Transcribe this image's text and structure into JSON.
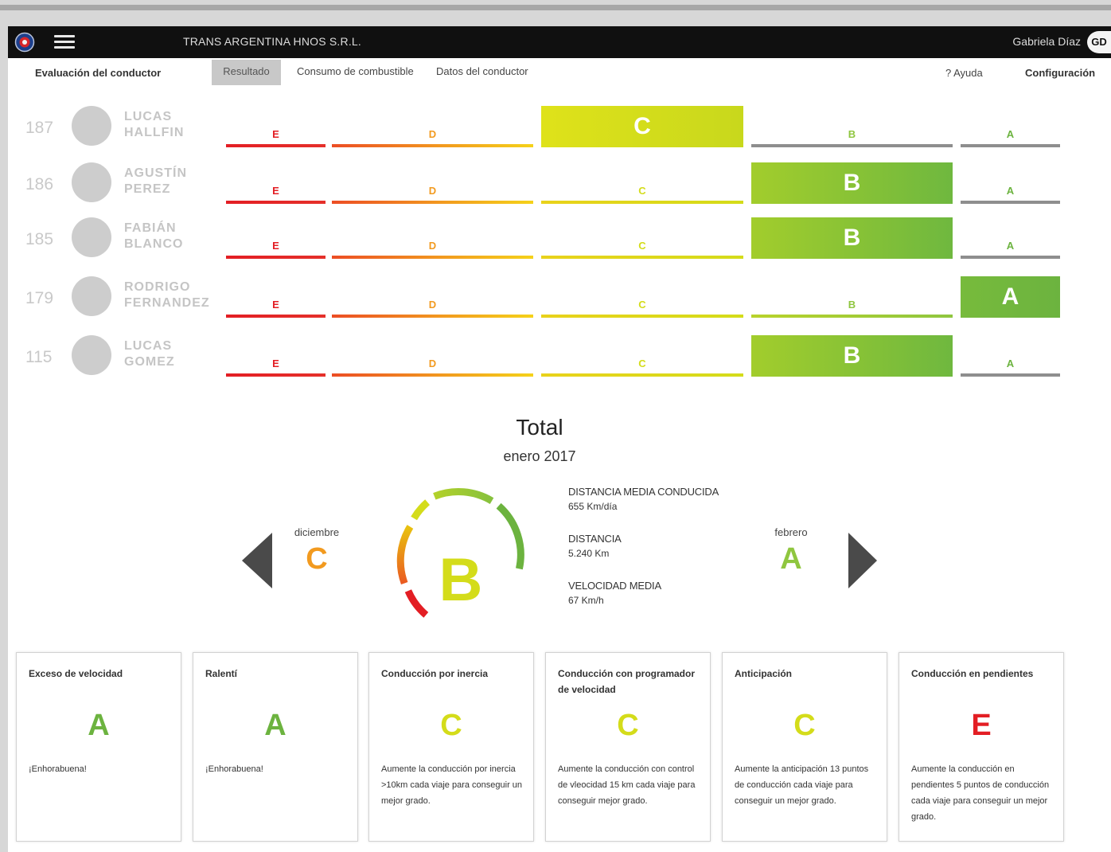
{
  "header": {
    "company": "TRANS ARGENTINA HNOS S.R.L.",
    "user_name": "Gabriela Díaz",
    "user_initials": "GD"
  },
  "nav": {
    "title": "Evaluación del conductor",
    "tabs": [
      "Resultado",
      "Consumo de combustible",
      "Datos del conductor"
    ],
    "active_tab": "Resultado",
    "help": "? Ayuda",
    "config": "Configuración"
  },
  "grade_scale": [
    "E",
    "D",
    "C",
    "B",
    "A"
  ],
  "colors": {
    "E": "#e31e24",
    "D": "#f29a1f",
    "C": "#d4dc1a",
    "B": "#8fc63f",
    "A": "#6cb33f",
    "inactive_line": "#8e8e8e",
    "arrow": "#4a4a4a"
  },
  "drivers": [
    {
      "id": "187",
      "first": "LUCAS",
      "last": "HALLFIN",
      "grade": "C"
    },
    {
      "id": "186",
      "first": "AGUSTÍN",
      "last": "PEREZ",
      "grade": "B"
    },
    {
      "id": "185",
      "first": "FABIÁN",
      "last": "BLANCO",
      "grade": "B"
    },
    {
      "id": "179",
      "first": "RODRIGO",
      "last": "FERNANDEZ",
      "grade": "A"
    },
    {
      "id": "115",
      "first": "LUCAS",
      "last": "GOMEZ",
      "grade": "B"
    }
  ],
  "total": {
    "title": "Total",
    "period": "enero 2017",
    "grade": "B",
    "prev": {
      "month": "diciembre",
      "grade": "C"
    },
    "next": {
      "month": "febrero",
      "grade": "A"
    },
    "stats": [
      {
        "label": "DISTANCIA MEDIA CONDUCIDA",
        "value": "655 Km/día"
      },
      {
        "label": "DISTANCIA",
        "value": "5.240 Km"
      },
      {
        "label": "VELOCIDAD MEDIA",
        "value": "67 Km/h"
      }
    ]
  },
  "cards": [
    {
      "title": "Exceso de velocidad",
      "grade": "A",
      "text": "¡Enhorabuena!"
    },
    {
      "title": "Ralentí",
      "grade": "A",
      "text": "¡Enhorabuena!"
    },
    {
      "title": "Conducción por inercia",
      "grade": "C",
      "text": "Aumente la conducción por inercia >10km cada viaje para conseguir un mejor grado."
    },
    {
      "title": "Conducción con programador de velocidad",
      "grade": "C",
      "text": "Aumente la conducción con control de vleocidad 15 km cada viaje para conseguir mejor grado."
    },
    {
      "title": "Anticipación",
      "grade": "C",
      "text": "Aumente la anticipación 13 puntos de conducción cada viaje para conseguir un mejor grado."
    },
    {
      "title": "Conducción en pendientes",
      "grade": "E",
      "text": "Aumente la conducción en pendientes 5 puntos de conducción cada viaje para conseguir un mejor grado."
    }
  ]
}
